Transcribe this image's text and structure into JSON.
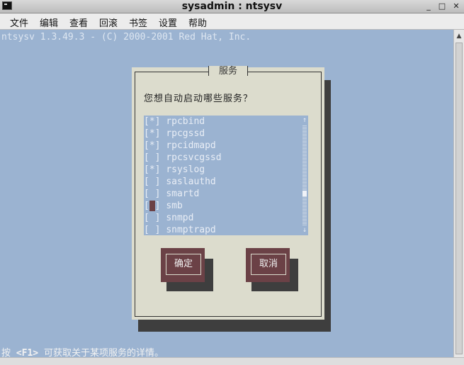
{
  "window": {
    "title": "sysadmin : ntsysv",
    "minimize_glyph": "_",
    "maximize_glyph": "□",
    "close_glyph": "✕"
  },
  "menubar": {
    "items": [
      "文件",
      "编辑",
      "查看",
      "回滚",
      "书签",
      "设置",
      "帮助"
    ]
  },
  "terminal": {
    "header": "ntsysv 1.3.49.3 - (C) 2000-2001 Red Hat, Inc.",
    "footer_pre": "按 ",
    "footer_key": "<F1>",
    "footer_post": " 可获取关于某项服务的详情。"
  },
  "dialog": {
    "title": "服务",
    "prompt": "您想自动启动哪些服务？",
    "services": [
      {
        "checkbox": "[*]",
        "name": "rpcbind"
      },
      {
        "checkbox": "[*]",
        "name": "rpcgssd"
      },
      {
        "checkbox": "[*]",
        "name": "rpcidmapd"
      },
      {
        "checkbox": "[ ]",
        "name": "rpcsvcgssd"
      },
      {
        "checkbox": "[*]",
        "name": "rsyslog"
      },
      {
        "checkbox": "[ ]",
        "name": "saslauthd"
      },
      {
        "checkbox": "[ ]",
        "name": "smartd"
      },
      {
        "checkbox": "[ ]",
        "name": "smb",
        "focused": true
      },
      {
        "checkbox": "[ ]",
        "name": "snmpd"
      },
      {
        "checkbox": "[ ]",
        "name": "snmptrapd"
      }
    ],
    "scroll_up": "↑",
    "scroll_down": "↓",
    "ok_label": "确定",
    "cancel_label": "取消"
  },
  "colors": {
    "terminal_bg": "#9bb3d1",
    "dialog_bg": "#dcdccd",
    "button_bg": "#6b4146",
    "shadow": "#3e3e3e"
  }
}
